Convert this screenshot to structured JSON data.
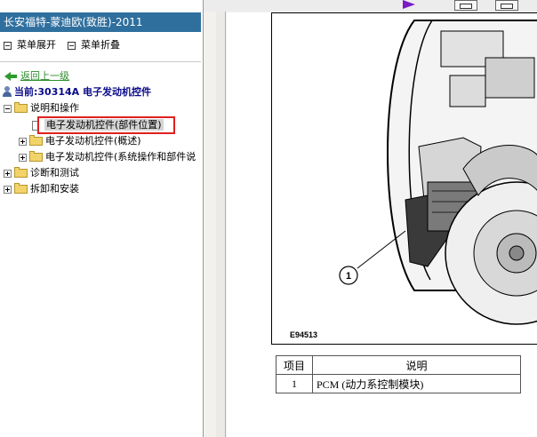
{
  "app": {
    "window_title": "长安福特-蒙迪欧(致胜)-2011"
  },
  "left_menu": {
    "expand_all": "菜单展开",
    "collapse_all": "菜单折叠"
  },
  "nav": {
    "back_label": "返回上一级",
    "current_label": "当前:30314A 电子发动机控件"
  },
  "tree": {
    "nodes": [
      {
        "label": "说明和操作",
        "state": "expanded"
      },
      {
        "label": "电子发动机控件(部件位置)",
        "state": "selected"
      },
      {
        "label": "电子发动机控件(概述)",
        "state": "collapsed"
      },
      {
        "label": "电子发动机控件(系统操作和部件说",
        "state": "collapsed"
      },
      {
        "label": "诊断和测试",
        "state": "collapsed"
      },
      {
        "label": "拆卸和安装",
        "state": "collapsed"
      }
    ]
  },
  "figure": {
    "callout": "1",
    "image_id": "E94513"
  },
  "parts_table": {
    "headers": [
      "项目",
      "说明"
    ],
    "rows": [
      {
        "item": "1",
        "description": "PCM (动力系控制模块)"
      }
    ]
  },
  "colors": {
    "title_bar": "#2f6f9e",
    "link_green": "#2c8c2c",
    "current_blue": "#0a0a8a",
    "highlight_red": "#e02020"
  }
}
